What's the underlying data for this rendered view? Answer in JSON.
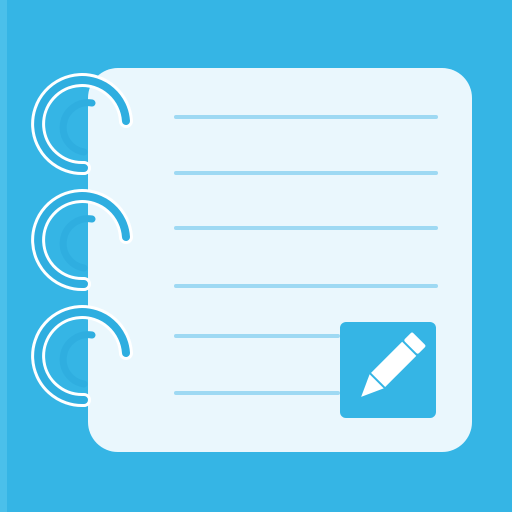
{
  "app_icon": {
    "name": "notepad-icon",
    "colors": {
      "background": "#35B5E5",
      "left_edge": "#4BC0EA",
      "page": "#EAF7FD",
      "rule_lines": "#9ED9F3",
      "rings": "#2FAEE0",
      "ring_highlight": "#FFFFFF",
      "pencil_badge": "#35B5E5",
      "pencil": "#FFFFFF"
    },
    "rule_line_count": 6,
    "ring_count": 3
  }
}
